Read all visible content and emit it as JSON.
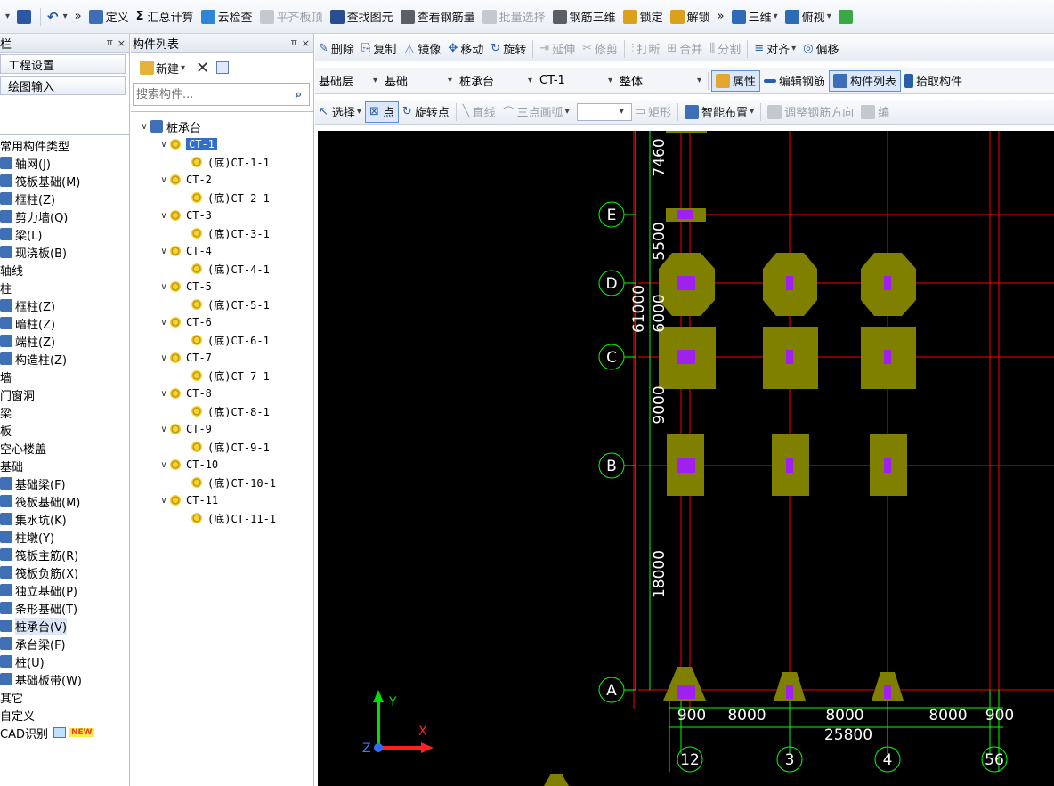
{
  "toolbar": {
    "items": [
      {
        "label": "定义",
        "icon": "define-icon"
      },
      {
        "label": "汇总计算",
        "prefix": "Σ"
      },
      {
        "label": "云检查",
        "icon": "cloud-check-icon"
      },
      {
        "label": "平齐板顶",
        "icon": "align-slab-icon",
        "disabled": true
      },
      {
        "label": "查找图元",
        "icon": "binoculars-icon"
      },
      {
        "label": "查看钢筋量",
        "icon": "rebar-qty-icon"
      },
      {
        "label": "批量选择",
        "icon": "batch-select-icon",
        "disabled": true
      },
      {
        "label": "钢筋三维",
        "icon": "rebar-3d-icon"
      },
      {
        "label": "锁定",
        "icon": "lock-icon"
      },
      {
        "label": "解锁",
        "icon": "unlock-icon"
      },
      {
        "label": "三维",
        "icon": "3d-view-icon"
      },
      {
        "label": "俯视",
        "icon": "top-view-icon"
      }
    ],
    "overflow": "»"
  },
  "left_panel": {
    "title": "栏",
    "pin": "ㅍ ×",
    "nav": [
      "工程设置",
      "绘图输入"
    ],
    "items": [
      {
        "label": "常用构件类型",
        "type": "cat"
      },
      {
        "label": "轴网(J)",
        "type": "sub"
      },
      {
        "label": "筏板基础(M)",
        "type": "sub"
      },
      {
        "label": "框柱(Z)",
        "type": "sub"
      },
      {
        "label": "剪力墙(Q)",
        "type": "sub"
      },
      {
        "label": "梁(L)",
        "type": "sub"
      },
      {
        "label": "现浇板(B)",
        "type": "sub"
      },
      {
        "label": "轴线",
        "type": "cat"
      },
      {
        "label": "柱",
        "type": "cat"
      },
      {
        "label": "框柱(Z)",
        "type": "sub"
      },
      {
        "label": "暗柱(Z)",
        "type": "sub"
      },
      {
        "label": "端柱(Z)",
        "type": "sub"
      },
      {
        "label": "构造柱(Z)",
        "type": "sub"
      },
      {
        "label": "墙",
        "type": "cat"
      },
      {
        "label": "门窗洞",
        "type": "cat"
      },
      {
        "label": "梁",
        "type": "cat"
      },
      {
        "label": "板",
        "type": "cat"
      },
      {
        "label": "空心楼盖",
        "type": "cat"
      },
      {
        "label": "基础",
        "type": "cat"
      },
      {
        "label": "基础梁(F)",
        "type": "sub"
      },
      {
        "label": "筏板基础(M)",
        "type": "sub"
      },
      {
        "label": "集水坑(K)",
        "type": "sub"
      },
      {
        "label": "柱墩(Y)",
        "type": "sub"
      },
      {
        "label": "筏板主筋(R)",
        "type": "sub"
      },
      {
        "label": "筏板负筋(X)",
        "type": "sub"
      },
      {
        "label": "独立基础(P)",
        "type": "sub"
      },
      {
        "label": "条形基础(T)",
        "type": "sub"
      },
      {
        "label": "桩承台(V)",
        "type": "sub",
        "selected": true
      },
      {
        "label": "承台梁(F)",
        "type": "sub"
      },
      {
        "label": "桩(U)",
        "type": "sub"
      },
      {
        "label": "基础板带(W)",
        "type": "sub"
      },
      {
        "label": "其它",
        "type": "cat"
      },
      {
        "label": "自定义",
        "type": "cat"
      },
      {
        "label": "CAD识别",
        "type": "cat",
        "badge": "NEW"
      }
    ]
  },
  "comp_panel": {
    "title": "构件列表",
    "pin": "ㅍ ×",
    "new_label": "新建",
    "search_placeholder": "搜索构件...",
    "root": "桩承台",
    "items": [
      {
        "name": "CT-1",
        "child": "(底)CT-1-1",
        "selected": true
      },
      {
        "name": "CT-2",
        "child": "(底)CT-2-1"
      },
      {
        "name": "CT-3",
        "child": "(底)CT-3-1"
      },
      {
        "name": "CT-4",
        "child": "(底)CT-4-1"
      },
      {
        "name": "CT-5",
        "child": "(底)CT-5-1"
      },
      {
        "name": "CT-6",
        "child": "(底)CT-6-1"
      },
      {
        "name": "CT-7",
        "child": "(底)CT-7-1"
      },
      {
        "name": "CT-8",
        "child": "(底)CT-8-1"
      },
      {
        "name": "CT-9",
        "child": "(底)CT-9-1"
      },
      {
        "name": "CT-10",
        "child": "(底)CT-10-1"
      },
      {
        "name": "CT-11",
        "child": "(底)CT-11-1"
      }
    ]
  },
  "edit_toolbar": {
    "items": [
      "删除",
      "复制",
      "镜像",
      "移动",
      "旋转",
      "延伸",
      "修剪",
      "打断",
      "合并",
      "分割",
      "对齐",
      "偏移"
    ]
  },
  "selector_row": {
    "floor": "基础层",
    "category": "基础",
    "type": "桩承台",
    "component": "CT-1",
    "scope": "整体",
    "buttons": [
      "属性",
      "编辑钢筋",
      "构件列表",
      "拾取构件"
    ]
  },
  "draw_row": {
    "items": [
      "选择",
      "点",
      "旋转点",
      "直线",
      "三点画弧",
      "矩形",
      "智能布置",
      "调整钢筋方向",
      "编"
    ]
  },
  "drawing": {
    "axis_rows": [
      "E",
      "D",
      "C",
      "B",
      "A"
    ],
    "axis_cols": [
      "12",
      "3",
      "4",
      "56"
    ],
    "dims_vertical": [
      "7460",
      "5500",
      "6000",
      "61000",
      "9000",
      "18000"
    ],
    "dims_horizontal": [
      "900",
      "8000",
      "8000",
      "8000",
      "900"
    ],
    "total_width": "25800",
    "ucs": {
      "x": "X",
      "y": "Y",
      "z": "Z"
    },
    "colors": {
      "background": "#000000",
      "axis": "#ff0000",
      "cap": "#808000",
      "pile": "#9b1aff",
      "dim": "#00ff00",
      "text": "#ffffff"
    }
  }
}
